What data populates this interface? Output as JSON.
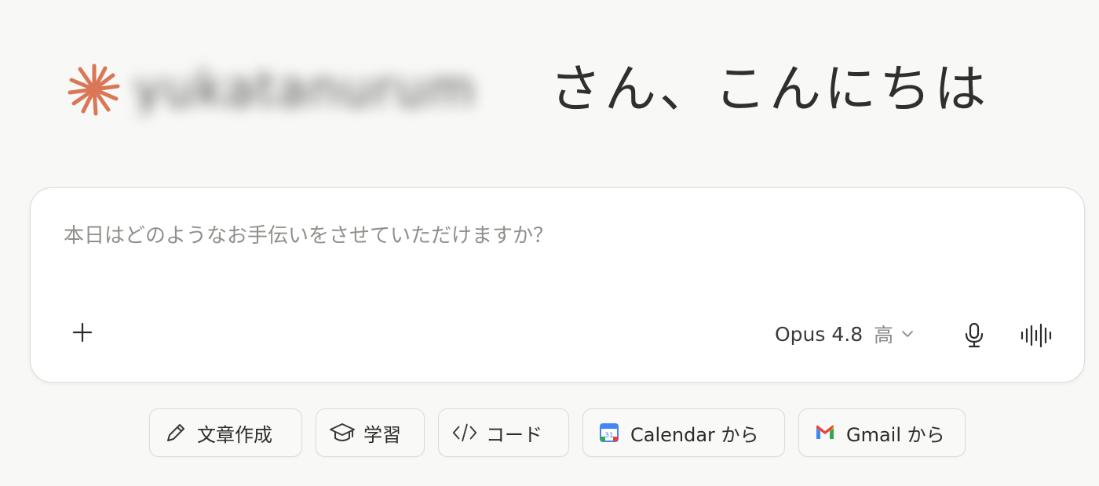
{
  "greeting": {
    "user_name": "yukatanurum",
    "text": "さん、こんにちは"
  },
  "composer": {
    "placeholder": "本日はどのようなお手伝いをさせていただけますか？",
    "value": "",
    "model_name": "Opus 4.8",
    "effort_level": "高"
  },
  "chips": [
    {
      "label": "文章作成",
      "icon": "pencil-icon"
    },
    {
      "label": "学習",
      "icon": "graduation-cap-icon"
    },
    {
      "label": "コード",
      "icon": "code-icon"
    },
    {
      "label": "Calendar から",
      "icon": "google-calendar-icon"
    },
    {
      "label": "Gmail から",
      "icon": "gmail-icon"
    }
  ],
  "colors": {
    "accent": "#d97757",
    "background": "#f8f8f6",
    "placeholder": "#8f8f8b"
  }
}
